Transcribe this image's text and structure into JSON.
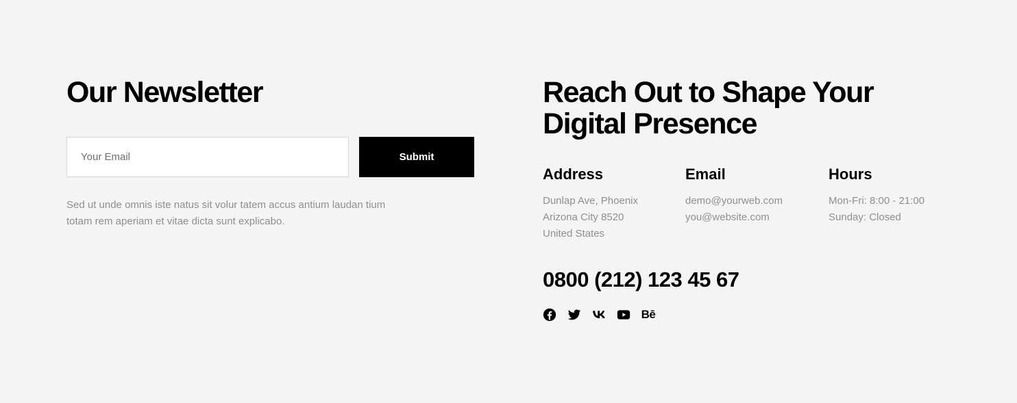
{
  "newsletter": {
    "title": "Our Newsletter",
    "email_placeholder": "Your Email",
    "submit_label": "Submit",
    "description_line1": "Sed ut unde omnis iste natus sit volur tatem accus antium laudan tium",
    "description_line2": "totam rem aperiam et vitae dicta sunt explicabo."
  },
  "contact": {
    "title_line1": "Reach Out to Shape Your",
    "title_line2": "Digital Presence",
    "address": {
      "heading": "Address",
      "lines": [
        "Dunlap Ave, Phoenix",
        "Arizona City 8520",
        "United States"
      ]
    },
    "email": {
      "heading": "Email",
      "lines": [
        "demo@yourweb.com",
        "you@website.com"
      ]
    },
    "hours": {
      "heading": "Hours",
      "lines": [
        "Mon-Fri: 8:00 - 21:00",
        "Sunday: Closed"
      ]
    },
    "phone": "0800 (212) 123 45 67",
    "socials": [
      {
        "icon": "facebook-icon"
      },
      {
        "icon": "twitter-icon"
      },
      {
        "icon": "vk-icon"
      },
      {
        "icon": "youtube-icon"
      },
      {
        "icon": "behance-icon",
        "text": "Bē"
      }
    ]
  },
  "colors": {
    "background": "#f4f4f4",
    "text": "#000000",
    "muted": "#8f8f8f",
    "button": "#000000",
    "button_text": "#ffffff"
  }
}
